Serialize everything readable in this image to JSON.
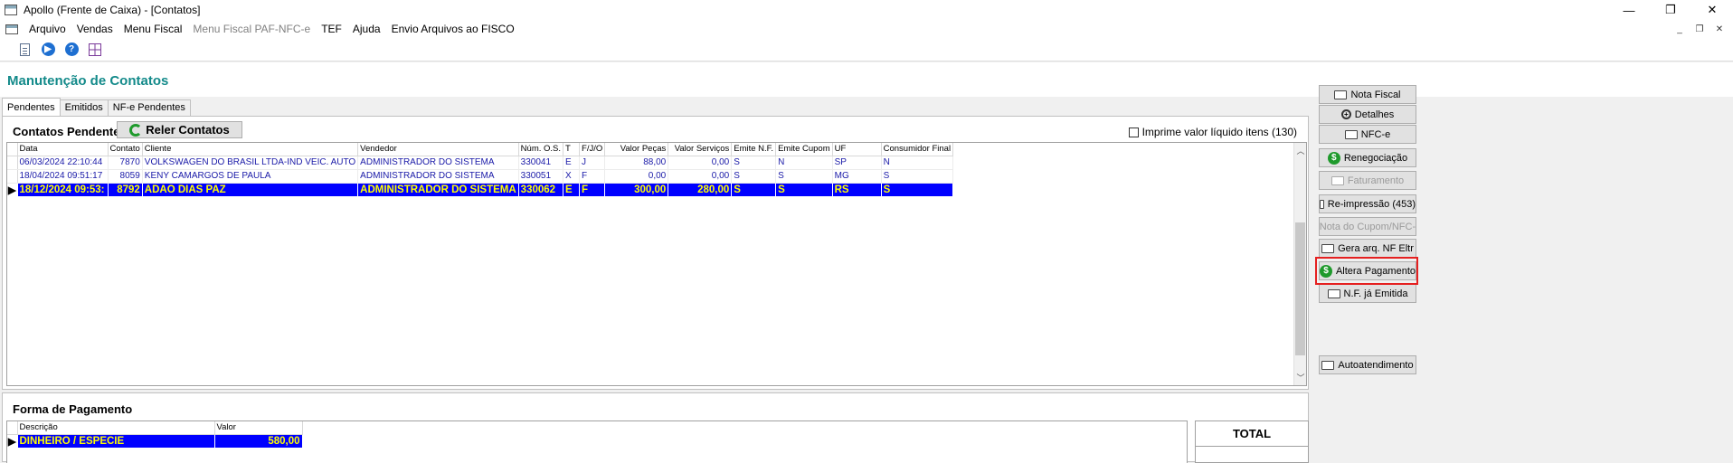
{
  "window": {
    "title": "Apollo (Frente de Caixa) - [Contatos]",
    "minimize": "—",
    "restore": "❐",
    "close": "✕"
  },
  "menu": {
    "items": [
      {
        "label": "Arquivo",
        "disabled": false
      },
      {
        "label": "Vendas",
        "disabled": false
      },
      {
        "label": "Menu Fiscal",
        "disabled": false
      },
      {
        "label": "Menu Fiscal PAF-NFC-e",
        "disabled": true
      },
      {
        "label": "TEF",
        "disabled": false
      },
      {
        "label": "Ajuda",
        "disabled": false
      },
      {
        "label": "Envio Arquivos ao FISCO",
        "disabled": false
      }
    ],
    "mdi_min": "_",
    "mdi_restore": "❐",
    "mdi_close": "✕"
  },
  "toolbar": {
    "icons": [
      "document-icon",
      "play-icon",
      "help-icon",
      "grid-icon"
    ],
    "play_glyph": "▶",
    "help_glyph": "?"
  },
  "header": {
    "title": "Manutenção de Contatos"
  },
  "tabs": [
    {
      "label": "Pendentes",
      "active": true
    },
    {
      "label": "Emitidos",
      "active": false
    },
    {
      "label": "NF-e Pendentes",
      "active": false
    }
  ],
  "contacts_panel": {
    "title": "Contatos Pendentes",
    "reload_button": "Reler Contatos",
    "checkbox_label": "Imprime valor líquido itens (130)",
    "checkbox_checked": false,
    "columns": [
      "Data",
      "Contato",
      "Cliente",
      "Vendedor",
      "Núm. O.S.",
      "T",
      "F/J/O",
      "Valor Peças",
      "Valor Serviços",
      "Emite N.F.",
      "Emite Cupom",
      "UF",
      "Consumidor Final"
    ],
    "rows": [
      {
        "selected": false,
        "cells": [
          "06/03/2024 22:10:44",
          "7870",
          "VOLKSWAGEN DO BRASIL LTDA-IND VEIC. AUTO",
          "ADMINISTRADOR DO SISTEMA",
          "330041",
          "E",
          "J",
          "88,00",
          "0,00",
          "S",
          "N",
          "SP",
          "N"
        ]
      },
      {
        "selected": false,
        "cells": [
          "18/04/2024 09:51:17",
          "8059",
          "KENY CAMARGOS DE PAULA",
          "ADMINISTRADOR DO SISTEMA",
          "330051",
          "X",
          "F",
          "0,00",
          "0,00",
          "S",
          "S",
          "MG",
          "S"
        ]
      },
      {
        "selected": true,
        "cells": [
          "18/12/2024 09:53:",
          "8792",
          "ADAO DIAS PAZ",
          "ADMINISTRADOR DO SISTEMA",
          "330062",
          "E",
          "F",
          "300,00",
          "280,00",
          "S",
          "S",
          "RS",
          "S"
        ]
      }
    ],
    "row_indicator": "▶"
  },
  "payment_panel": {
    "title": "Forma de Pagamento",
    "columns": [
      "Descrição",
      "Valor"
    ],
    "rows": [
      {
        "selected": true,
        "cells": [
          "DINHEIRO / ESPECIE",
          "580,00"
        ]
      }
    ],
    "total_label": "TOTAL"
  },
  "side_buttons": [
    {
      "label": "Nota Fiscal",
      "icon": "print-icon",
      "disabled": false
    },
    {
      "label": "Detalhes",
      "icon": "magnifier-icon",
      "disabled": false
    },
    {
      "label": "NFC-e",
      "icon": "print-icon",
      "disabled": false
    },
    {
      "label": "Renegociação",
      "icon": "dollar-icon",
      "disabled": false
    },
    {
      "label": "Faturamento",
      "icon": "print-icon",
      "disabled": true
    },
    {
      "label": "Re-impressão (453)",
      "icon": "print-icon",
      "disabled": false
    },
    {
      "label": "Nota do Cupom/NFC-e",
      "icon": "print-icon",
      "disabled": true
    },
    {
      "label": "Gera arq. NF Eltr",
      "icon": "document-icon",
      "disabled": false
    },
    {
      "label": "Altera Pagamento",
      "icon": "dollar-icon",
      "disabled": false,
      "highlighted": true
    },
    {
      "label": "N.F. já Emitida",
      "icon": "print-icon",
      "disabled": false
    },
    {
      "label": "Autoatendimento",
      "icon": "print-icon",
      "disabled": false
    }
  ],
  "colors": {
    "accent_title": "#138a8a",
    "selection_bg": "#0000ff",
    "selection_text": "#ffff00",
    "row_text": "#1a1aa8",
    "highlight": "#e52020"
  }
}
